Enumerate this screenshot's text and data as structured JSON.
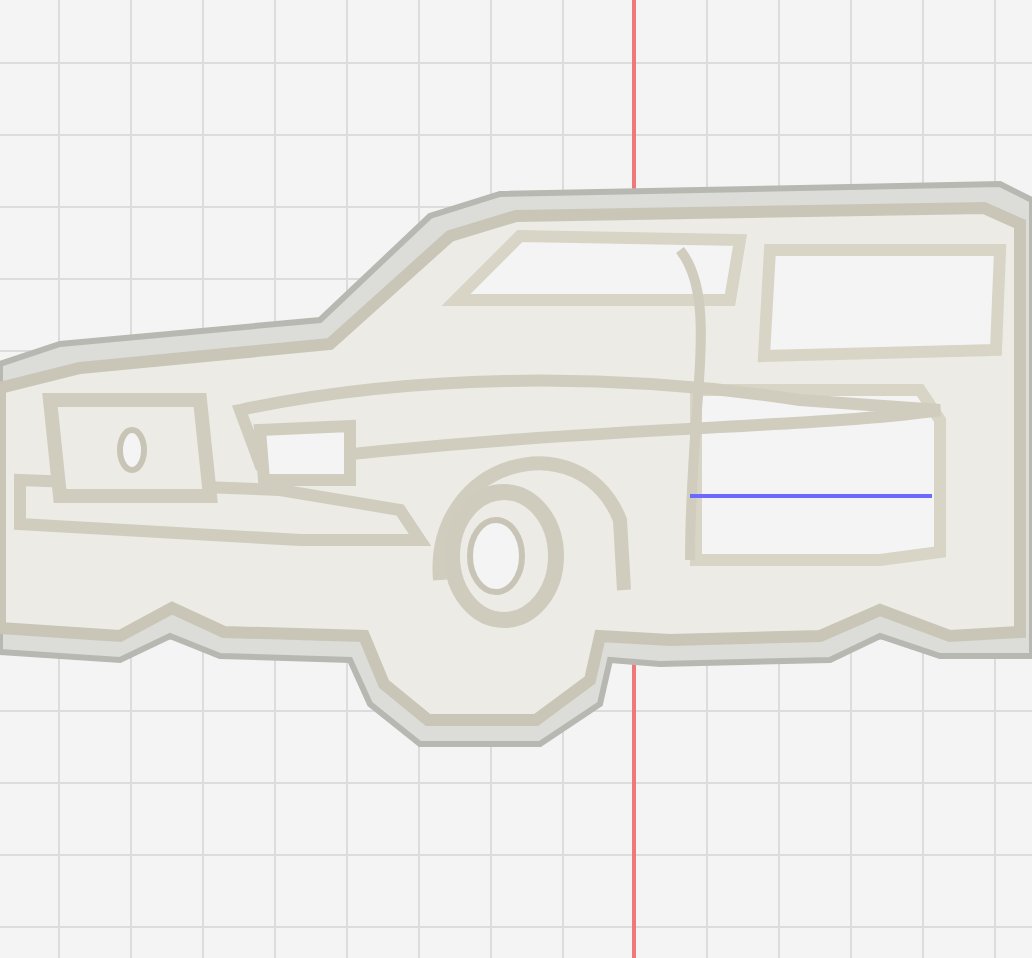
{
  "viewport": {
    "grid_visible": true,
    "axes": [
      {
        "kind": "vertical",
        "color": "#f07878"
      },
      {
        "kind": "horizontal",
        "color": "#6a6aff"
      }
    ]
  }
}
